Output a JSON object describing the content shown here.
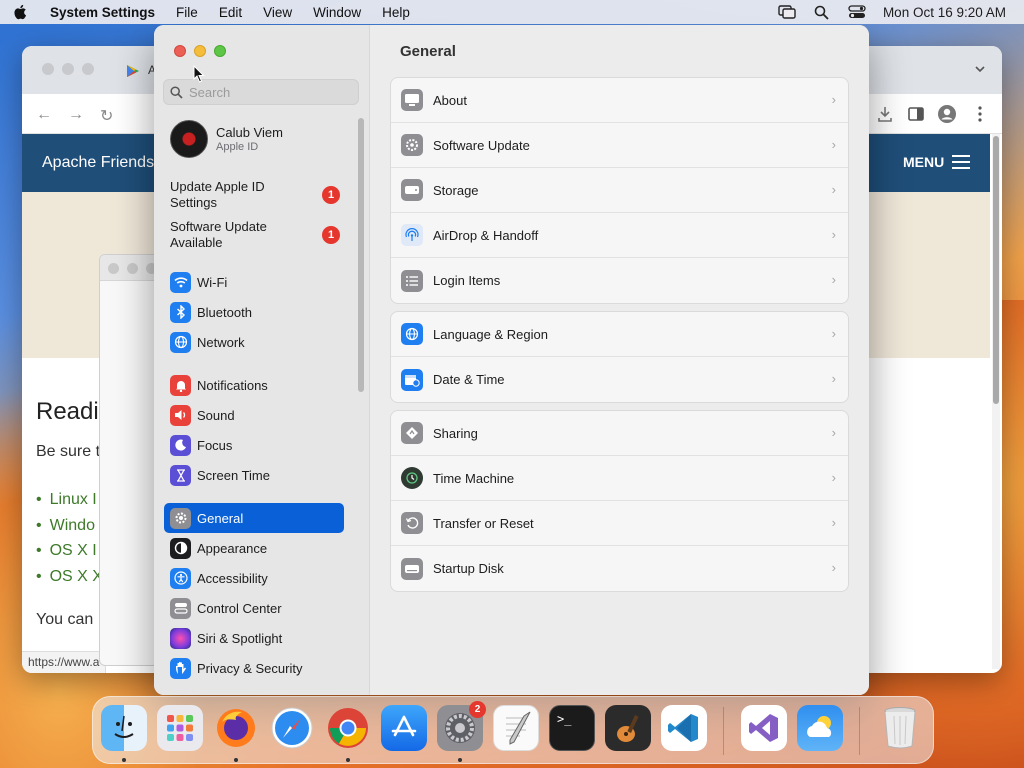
{
  "menubar": {
    "app_name": "System Settings",
    "items": [
      "File",
      "Edit",
      "View",
      "Window",
      "Help"
    ],
    "clock": "Mon Oct 16  9:20 AM",
    "status_icons": [
      "screen-mirroring-icon",
      "spotlight-search-icon",
      "control-center-icon"
    ]
  },
  "browser": {
    "tab_title": "A",
    "site_title": "Apache Friends",
    "menu_label": "MENU",
    "heading": "Readi",
    "paragraph": "Be sure t",
    "list": [
      "Linux I",
      "Windo",
      "OS X I",
      "OS X X"
    ],
    "paragraph2": "You can",
    "status_url": "https://www.a"
  },
  "settings": {
    "search_placeholder": "Search",
    "profile": {
      "name": "Calub Viem",
      "subtitle": "Apple ID"
    },
    "notices": [
      {
        "label": "Update Apple ID Settings",
        "badge": "1"
      },
      {
        "label": "Software Update Available",
        "badge": "1"
      }
    ],
    "sidebar_groups": [
      [
        {
          "label": "Wi-Fi",
          "icon": "wifi-icon",
          "color": "#1f7ef0"
        },
        {
          "label": "Bluetooth",
          "icon": "bluetooth-icon",
          "color": "#1f7ef0"
        },
        {
          "label": "Network",
          "icon": "network-icon",
          "color": "#1f7ef0"
        }
      ],
      [
        {
          "label": "Notifications",
          "icon": "notifications-icon",
          "color": "#e8423b"
        },
        {
          "label": "Sound",
          "icon": "sound-icon",
          "color": "#e8423b"
        },
        {
          "label": "Focus",
          "icon": "focus-icon",
          "color": "#5b4fd6"
        },
        {
          "label": "Screen Time",
          "icon": "screen-time-icon",
          "color": "#5b4fd6"
        }
      ],
      [
        {
          "label": "General",
          "icon": "gear-icon",
          "color": "#8e8e93",
          "selected": true
        },
        {
          "label": "Appearance",
          "icon": "appearance-icon",
          "color": "#1d1d1f"
        },
        {
          "label": "Accessibility",
          "icon": "accessibility-icon",
          "color": "#1f7ef0"
        },
        {
          "label": "Control Center",
          "icon": "control-center-icon",
          "color": "#8e8e93"
        },
        {
          "label": "Siri & Spotlight",
          "icon": "siri-icon",
          "color": "#c23bd9"
        },
        {
          "label": "Privacy & Security",
          "icon": "privacy-hand-icon",
          "color": "#1f7ef0"
        }
      ]
    ],
    "content_title": "General",
    "groups": [
      [
        {
          "label": "About",
          "icon": "about-icon",
          "color": "#8e8e93"
        },
        {
          "label": "Software Update",
          "icon": "software-update-icon",
          "color": "#8e8e93"
        },
        {
          "label": "Storage",
          "icon": "storage-icon",
          "color": "#8e8e93"
        },
        {
          "label": "AirDrop & Handoff",
          "icon": "airdrop-icon",
          "color": "#dfe9f7"
        },
        {
          "label": "Login Items",
          "icon": "login-items-icon",
          "color": "#8e8e93"
        }
      ],
      [
        {
          "label": "Language & Region",
          "icon": "globe-icon",
          "color": "#1f7ef0"
        },
        {
          "label": "Date & Time",
          "icon": "calendar-clock-icon",
          "color": "#1f7ef0"
        }
      ],
      [
        {
          "label": "Sharing",
          "icon": "sharing-icon",
          "color": "#8e8e93"
        },
        {
          "label": "Time Machine",
          "icon": "time-machine-icon",
          "color": "#2f3a33"
        },
        {
          "label": "Transfer or Reset",
          "icon": "transfer-reset-icon",
          "color": "#8e8e93"
        },
        {
          "label": "Startup Disk",
          "icon": "startup-disk-icon",
          "color": "#8e8e93"
        }
      ]
    ]
  },
  "dock": {
    "apps": [
      {
        "name": "finder-icon",
        "running": true
      },
      {
        "name": "launchpad-icon",
        "running": false
      },
      {
        "name": "firefox-icon",
        "running": true
      },
      {
        "name": "safari-icon",
        "running": false
      },
      {
        "name": "chrome-icon",
        "running": true
      },
      {
        "name": "app-store-icon",
        "running": false
      },
      {
        "name": "system-settings-icon",
        "running": true,
        "badge": "2"
      },
      {
        "name": "textedit-icon",
        "running": false
      },
      {
        "name": "terminal-icon",
        "running": false
      },
      {
        "name": "garageband-icon",
        "running": false
      },
      {
        "name": "vscode-icon",
        "running": false
      },
      {
        "name": "visual-studio-icon",
        "running": false
      },
      {
        "name": "weather-icon",
        "running": false
      },
      {
        "name": "trash-icon",
        "running": false
      }
    ]
  }
}
